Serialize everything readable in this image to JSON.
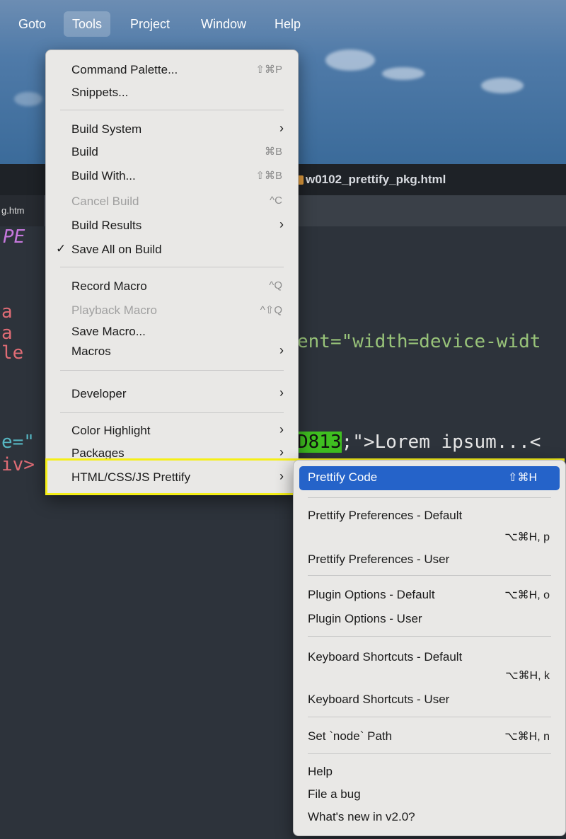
{
  "menubar": {
    "items": [
      "Goto",
      "Tools",
      "Project",
      "Window",
      "Help"
    ]
  },
  "tab": {
    "title": "w0102_prettify_pkg.html",
    "left_tab": "g.htm"
  },
  "code": {
    "l1": "PE",
    "l2a": "a",
    "l2b": "a",
    "l2c": "le",
    "mid": "ent=\"width=device-widt",
    "l3a": "e=\"",
    "l3hex": "D813",
    "l3rest": ";\">Lorem ipsum...<",
    "l4": "iv>"
  },
  "tools_menu": {
    "items": [
      {
        "label": "Command Palette...",
        "shortcut": "⇧⌘P"
      },
      {
        "label": "Snippets..."
      },
      {
        "label": "Build System",
        "submenu": true
      },
      {
        "label": "Build",
        "shortcut": "⌘B"
      },
      {
        "label": "Build With...",
        "shortcut": "⇧⌘B"
      },
      {
        "label": "Cancel Build",
        "shortcut": "^C",
        "disabled": true
      },
      {
        "label": "Build Results",
        "submenu": true
      },
      {
        "label": "Save All on Build",
        "checked": true
      },
      {
        "label": "Record Macro",
        "shortcut": "^Q"
      },
      {
        "label": "Playback Macro",
        "shortcut": "^⇧Q",
        "disabled": true
      },
      {
        "label": "Save Macro..."
      },
      {
        "label": "Macros",
        "submenu": true
      },
      {
        "label": "Developer",
        "submenu": true
      },
      {
        "label": "Color Highlight",
        "submenu": true
      },
      {
        "label": "Packages",
        "submenu": true
      },
      {
        "label": "HTML/CSS/JS Prettify",
        "submenu": true
      }
    ],
    "check_mark": "✓",
    "arrow": "›"
  },
  "prettify_menu": {
    "items": [
      {
        "label": "Prettify Code",
        "shortcut": "⇧⌘H"
      },
      {
        "label": "Prettify Preferences - Default",
        "shortcut": "⌥⌘H, p"
      },
      {
        "label": "Prettify Preferences - User"
      },
      {
        "label": "Plugin Options - Default",
        "shortcut": "⌥⌘H, o"
      },
      {
        "label": "Plugin Options - User"
      },
      {
        "label": "Keyboard Shortcuts - Default",
        "shortcut": "⌥⌘H, k"
      },
      {
        "label": "Keyboard Shortcuts - User"
      },
      {
        "label": "Set `node` Path",
        "shortcut": "⌥⌘H, n"
      },
      {
        "label": "Help"
      },
      {
        "label": "File a bug"
      },
      {
        "label": "What's new in v2.0?"
      }
    ]
  },
  "colors": {
    "selected": "#2563c9",
    "highlight_box": "#f5ef17",
    "menu_bg": "#e9e8e6"
  }
}
